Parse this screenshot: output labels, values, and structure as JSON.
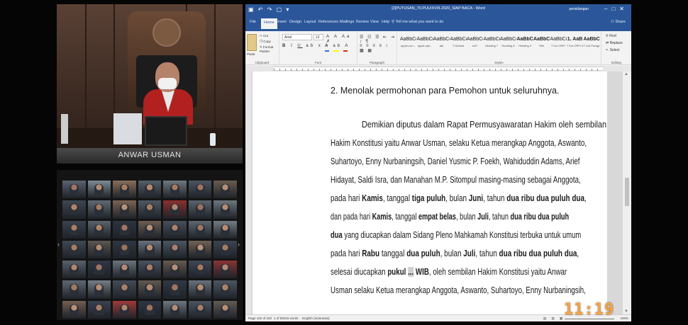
{
  "judge_feed": {
    "name_label": "ANWAR USMAN"
  },
  "participants": [
    {
      "name": "",
      "bg": "#5b6270",
      "skin": "#9c7563"
    },
    {
      "name": "",
      "bg": "#7d8b96",
      "skin": "#b48a72"
    },
    {
      "name": "",
      "bg": "#8a6f5a",
      "skin": "#a87c62"
    },
    {
      "name": "",
      "bg": "#54606a",
      "skin": "#b28770"
    },
    {
      "name": "",
      "bg": "#6e7880",
      "skin": "#a77a5f"
    },
    {
      "name": "",
      "bg": "#4b5560",
      "skin": "#9e735d"
    },
    {
      "name": "",
      "bg": "#6a5c50",
      "skin": "#b68e76"
    },
    {
      "name": "",
      "bg": "#3d4652",
      "skin": "#b08366"
    },
    {
      "name": "",
      "bg": "#606a74",
      "skin": "#a37a63"
    },
    {
      "name": "",
      "bg": "#7a6454",
      "skin": "#b99178"
    },
    {
      "name": "",
      "bg": "#4f5963",
      "skin": "#a57d66"
    },
    {
      "name": "",
      "bg": "#8c3030",
      "skin": "#b28770"
    },
    {
      "name": "",
      "bg": "#5a646e",
      "skin": "#9d7460"
    },
    {
      "name": "",
      "bg": "#6d757e",
      "skin": "#b48b73"
    },
    {
      "name": "",
      "bg": "#3a4350",
      "skin": "#a77d64"
    },
    {
      "name": "",
      "bg": "#59636d",
      "skin": "#b08468"
    },
    {
      "name": "",
      "bg": "#2c3440",
      "skin": "#a1775f"
    },
    {
      "name": "",
      "bg": "#6b5e52",
      "skin": "#b78f77"
    },
    {
      "name": "",
      "bg": "#464f5a",
      "skin": "#ab8168"
    },
    {
      "name": "",
      "bg": "#5d6771",
      "skin": "#9f7660"
    },
    {
      "name": "",
      "bg": "#737c85",
      "skin": "#b68c73"
    },
    {
      "name": "",
      "bg": "#3f4853",
      "skin": "#a67c63"
    },
    {
      "name": "",
      "bg": "#5c5650",
      "skin": "#b28a71"
    },
    {
      "name": "",
      "bg": "#2e3642",
      "skin": "#9d735d"
    },
    {
      "name": "",
      "bg": "#67717b",
      "skin": "#b58c74"
    },
    {
      "name": "",
      "bg": "#4c5661",
      "skin": "#a9806a"
    },
    {
      "name": "",
      "bg": "#706356",
      "skin": "#b99279"
    },
    {
      "name": "",
      "bg": "#3b4451",
      "skin": "#a47b64"
    },
    {
      "name": "",
      "bg": "#58626c",
      "skin": "#b08670"
    },
    {
      "name": "",
      "bg": "#2f3743",
      "skin": "#9b735e"
    },
    {
      "name": "",
      "bg": "#6a747d",
      "skin": "#b38a72"
    },
    {
      "name": "",
      "bg": "#495360",
      "skin": "#a77e67"
    },
    {
      "name": "",
      "bg": "#655a50",
      "skin": "#b78f76"
    },
    {
      "name": "",
      "bg": "#3e4754",
      "skin": "#a27960"
    },
    {
      "name": "",
      "bg": "#8a3434",
      "skin": "#b28870"
    },
    {
      "name": "",
      "bg": "#5e6872",
      "skin": "#a07862"
    },
    {
      "name": "",
      "bg": "#747d86",
      "skin": "#b68d75"
    },
    {
      "name": "",
      "bg": "#424b56",
      "skin": "#a87f68"
    },
    {
      "name": "",
      "bg": "#5f5952",
      "skin": "#b38b72"
    },
    {
      "name": "",
      "bg": "#303844",
      "skin": "#9e7560"
    },
    {
      "name": "",
      "bg": "#68727c",
      "skin": "#b48b73"
    },
    {
      "name": "",
      "bg": "#4d5762",
      "skin": "#aa816a"
    },
    {
      "name": "",
      "bg": "#725f53",
      "skin": "#b89077"
    },
    {
      "name": "",
      "bg": "#394250",
      "skin": "#a57c65"
    },
    {
      "name": "",
      "bg": "#a03a3a",
      "skin": "#b18770"
    },
    {
      "name": "",
      "bg": "#2d3541",
      "skin": "#9c745f"
    },
    {
      "name": "",
      "bg": "#6c7680",
      "skin": "#b58c74"
    },
    {
      "name": "",
      "bg": "#4a5460",
      "skin": "#a97f68"
    },
    {
      "name": "",
      "bg": "#625b54",
      "skin": "#b68e75"
    }
  ],
  "word": {
    "title": "[2]PUTUSAN_70.PUU/XVIII.2020_SIAP BACA - Word",
    "user": "persidangan",
    "tabs": [
      "File",
      "Home",
      "Insert",
      "Design",
      "Layout",
      "References",
      "Mailings",
      "Review",
      "View",
      "Help"
    ],
    "active_tab": "Home",
    "tell_me": "Tell me what you want to do",
    "share": "Share",
    "clipboard": {
      "paste": "Paste",
      "cut": "Cut",
      "copy": "Copy",
      "format_painter": "Format Painter",
      "group": "Clipboard"
    },
    "font": {
      "name": "Arial",
      "size": "12",
      "group": "Font"
    },
    "paragraph_group": "Paragraph",
    "styles_group": "Styles",
    "styles": [
      {
        "sample": "AaBbCcI",
        "name": "apple-con..."
      },
      {
        "sample": "AaBbCcI",
        "name": "apple-styl..."
      },
      {
        "sample": "AaBbCcI",
        "name": "abi"
      },
      {
        "sample": "AaBbCcI",
        "name": "T Default"
      },
      {
        "sample": "AaBbCcDd",
        "name": "ecf7"
      },
      {
        "sample": "AaBbCcI",
        "name": "Heading 7"
      },
      {
        "sample": "AaBbCcI",
        "name": "Heading 8"
      },
      {
        "sample": "AaBbCc",
        "name": "Heading 9"
      },
      {
        "sample": "AaBbC",
        "name": "Title"
      },
      {
        "sample": "AaBbCcI",
        "name": "T Kol ORFI"
      },
      {
        "sample": "1. AaB",
        "name": "T Kol ORFI A"
      },
      {
        "sample": "AaBbCc",
        "name": "T List Paragr..."
      }
    ],
    "editing": {
      "find": "Find",
      "replace": "Replace",
      "select": "Select",
      "group": "Editing"
    },
    "status": {
      "page": "Page 162 of 163",
      "words": "1 of 55016 words",
      "language": "English (Indonesia)",
      "zoom": "100%"
    }
  },
  "document": {
    "line_01": "2.  Menolak permohonan para Pemohon untuk seluruhnya.",
    "line_02": "Demikian diputus dalam Rapat Permusyawaratan Hakim oleh sembilan",
    "line_03": "Hakim Konstitusi yaitu Anwar Usman, selaku Ketua merangkap Anggota, Aswanto,",
    "line_04": "Suhartoyo, Enny Nurbaningsih, Daniel Yusmic P. Foekh, Wahiduddin Adams, Arief",
    "line_05": "Hidayat, Saldi Isra, dan Manahan M.P. Sitompul masing-masing sebagai Anggota,",
    "l6": {
      "a": "pada hari ",
      "b": "Kamis",
      "c": ", tanggal ",
      "d": "tiga puluh",
      "e": ", bulan ",
      "f": "Juni",
      "g": ", tahun ",
      "h": "dua ribu dua puluh dua",
      "i": ","
    },
    "l7": {
      "a": "dan pada hari ",
      "b": "Kamis",
      "c": ", tanggal ",
      "d": "empat belas",
      "e": ", bulan ",
      "f": "Juli",
      "g": ", tahun ",
      "h": "dua ribu dua puluh"
    },
    "l8": {
      "a": "dua",
      "b": " yang diucapkan dalam Sidang Pleno Mahkamah Konstitusi terbuka untuk umum"
    },
    "l9": {
      "a": "pada hari ",
      "b": "Rabu",
      "c": " tanggal ",
      "d": "dua puluh",
      "e": ", bulan ",
      "f": "Juli",
      "g": ", tahun ",
      "h": "dua ribu dua puluh dua",
      "i": ","
    },
    "l10": {
      "a": "selesai diucapkan ",
      "b": "pukul ",
      "c": "...",
      "d": " WIB",
      "e": ", oleh sembilan Hakim Konstitusi yaitu Anwar"
    },
    "line_11": "Usman selaku Ketua merangkap Anggota, Aswanto, Suhartoyo, Enny Nurbaningsih,"
  },
  "clock": "11:19"
}
